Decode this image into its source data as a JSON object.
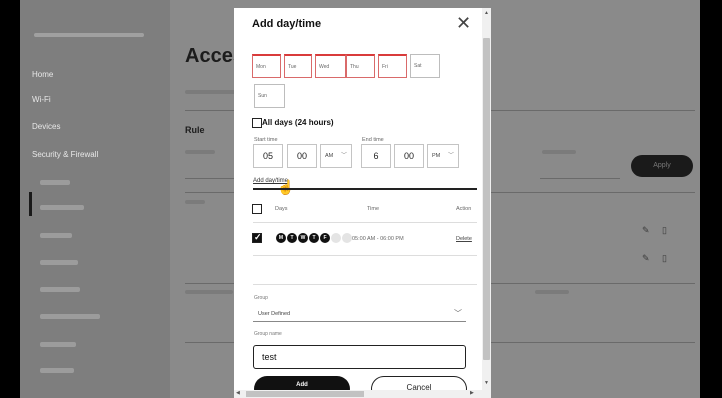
{
  "background": {
    "title": "Acces",
    "rule_label": "Rule",
    "apply_label": "Apply",
    "sidebar_items": [
      "Home",
      "Wi-Fi",
      "Devices",
      "Security & Firewall"
    ]
  },
  "modal": {
    "title": "Add day/time",
    "days": [
      {
        "label": "Mon",
        "selected": true
      },
      {
        "label": "Tue",
        "selected": true
      },
      {
        "label": "Wed",
        "selected": true
      },
      {
        "label": "Thu",
        "selected": true
      },
      {
        "label": "Fri",
        "selected": true
      },
      {
        "label": "Sat",
        "selected": false
      },
      {
        "label": "Sun",
        "selected": false
      }
    ],
    "all_days_label": "All days (24 hours)",
    "all_days_checked": false,
    "start_time": {
      "label": "Start time",
      "hour": "05",
      "minute": "00",
      "ampm": "AM"
    },
    "end_time": {
      "label": "End time",
      "hour": "6",
      "minute": "00",
      "ampm": "PM"
    },
    "add_link": "Add day/time",
    "table": {
      "headers": {
        "days": "Days",
        "time": "Time",
        "action": "Action"
      },
      "row": {
        "checked": true,
        "day_dots": [
          {
            "letter": "M",
            "active": true
          },
          {
            "letter": "T",
            "active": true
          },
          {
            "letter": "W",
            "active": true
          },
          {
            "letter": "T",
            "active": true
          },
          {
            "letter": "F",
            "active": true
          },
          {
            "letter": "S",
            "active": false
          },
          {
            "letter": "S",
            "active": false
          }
        ],
        "time": "05:00 AM - 06:00 PM",
        "action": "Delete"
      }
    },
    "group": {
      "label": "Group",
      "value": "User Defined"
    },
    "group_name": {
      "label": "Group name",
      "value": "test"
    },
    "add_button": "Add",
    "cancel_button": "Cancel"
  },
  "colors": {
    "selected_day_border": "#d93b3b",
    "primary": "#111111"
  }
}
